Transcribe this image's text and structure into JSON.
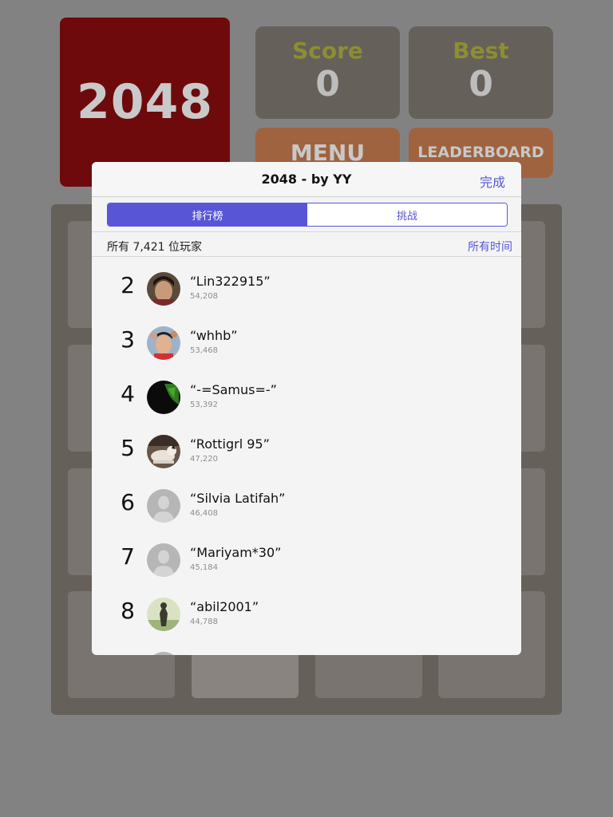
{
  "game": {
    "logo": "2048",
    "score_label": "Score",
    "score_value": "0",
    "best_label": "Best",
    "best_value": "0",
    "menu_label": "MENU",
    "leaderboard_label": "LEADERBOARD"
  },
  "modal": {
    "title": "2048 - by YY",
    "done_label": "完成",
    "tabs": [
      {
        "label": "排行榜",
        "active": true
      },
      {
        "label": "挑战",
        "active": false
      }
    ],
    "players_summary": "所有 7,421 位玩家",
    "time_filter": "所有时间",
    "entries": [
      {
        "rank": "2",
        "name": "“Lin322915”",
        "score": "54,208",
        "avatar": "person-photo"
      },
      {
        "rank": "3",
        "name": "“whhb”",
        "score": "53,468",
        "avatar": "group-photo"
      },
      {
        "rank": "4",
        "name": "“-=Samus=-”",
        "score": "53,392",
        "avatar": "dark-photo"
      },
      {
        "rank": "5",
        "name": "“Rottigrl 95”",
        "score": "47,220",
        "avatar": "dog-photo"
      },
      {
        "rank": "6",
        "name": "“Silvia Latifah”",
        "score": "46,408",
        "avatar": "default-avatar"
      },
      {
        "rank": "7",
        "name": "“Mariyam*30”",
        "score": "45,184",
        "avatar": "default-avatar"
      },
      {
        "rank": "8",
        "name": "“abil2001”",
        "score": "44,788",
        "avatar": "outdoor-photo"
      }
    ]
  },
  "colors": {
    "background": "#828282",
    "accent": "#5856d6",
    "logo_tile": "#6e0a0c",
    "button_orange": "#a0633f"
  }
}
